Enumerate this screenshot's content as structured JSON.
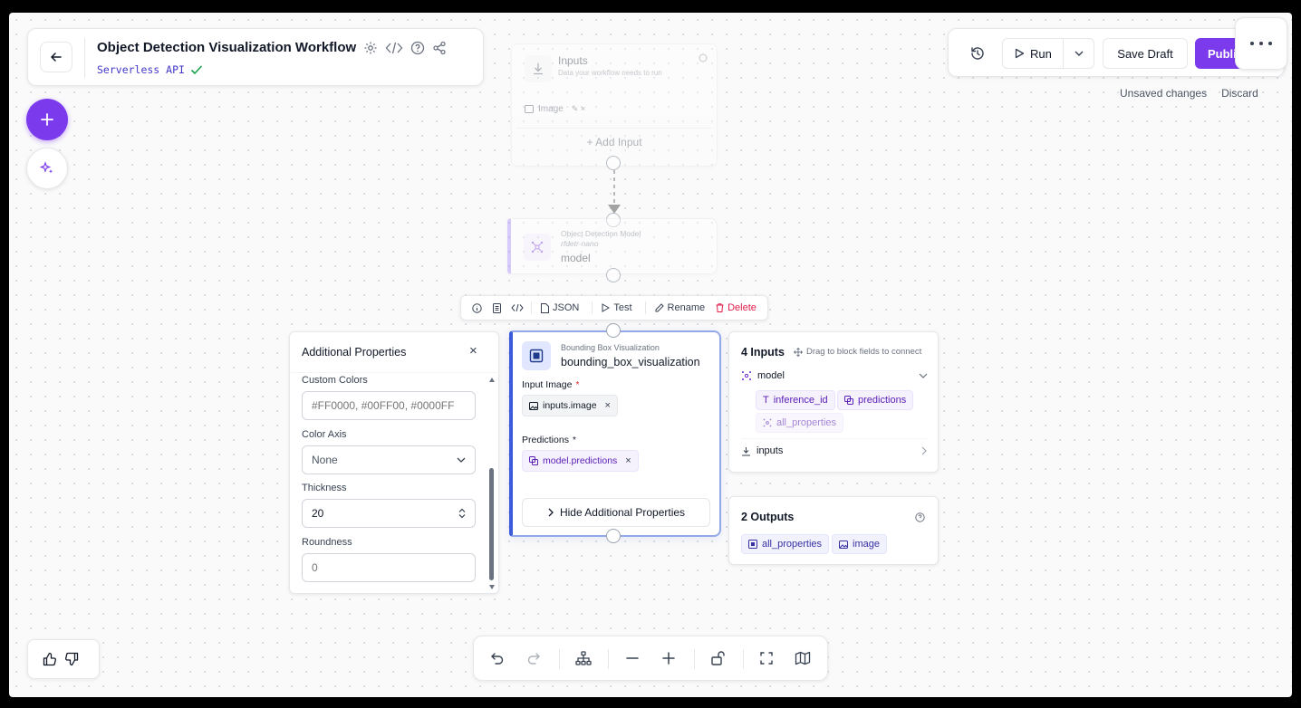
{
  "header": {
    "title": "Object Detection Visualization Workflow",
    "subtitle": "Serverless API",
    "icons": [
      "back-arrow-icon",
      "settings-icon",
      "code-icon",
      "help-icon",
      "share-icon"
    ]
  },
  "toolbar_right": {
    "run_label": "Run",
    "save_draft_label": "Save Draft",
    "publish_label": "Publi",
    "unsaved_label": "Unsaved changes",
    "discard_label": "Discard"
  },
  "inputs_node": {
    "title": "Inputs",
    "subtitle": "Data your workflow needs to run",
    "image_label": "Image",
    "add_input_label": "+ Add Input"
  },
  "model_node": {
    "type_label": "Object Detection Model",
    "model_id": "rfdetr-nano",
    "name": "model"
  },
  "node_toolbar": {
    "json_label": "JSON",
    "test_label": "Test",
    "rename_label": "Rename",
    "delete_label": "Delete"
  },
  "bbox_node": {
    "type_label": "Bounding Box Visualization",
    "name": "bounding_box_visualization",
    "input_image_label": "Input Image",
    "input_image_value": "inputs.image",
    "predictions_label": "Predictions",
    "predictions_value": "model.predictions",
    "hide_props_label": "Hide Additional Properties"
  },
  "additional_props": {
    "title": "Additional Properties",
    "custom_colors_label": "Custom Colors",
    "custom_colors_placeholder": "#FF0000, #00FF00, #0000FF",
    "color_axis_label": "Color Axis",
    "color_axis_value": "None",
    "thickness_label": "Thickness",
    "thickness_value": "20",
    "roundness_label": "Roundness",
    "roundness_placeholder": "0"
  },
  "inputs_panel": {
    "title": "4 Inputs",
    "hint": "Drag to block fields to connect",
    "model_label": "model",
    "chips": [
      "inference_id",
      "predictions",
      "all_properties"
    ],
    "inputs_label": "inputs"
  },
  "outputs_panel": {
    "title": "2 Outputs",
    "chips": [
      "all_properties",
      "image"
    ]
  },
  "bottom_toolbar": {
    "icons": [
      "undo-icon",
      "redo-icon",
      "layout-icon",
      "zoom-out-icon",
      "zoom-in-icon",
      "lock-icon",
      "fit-view-icon",
      "map-icon"
    ]
  },
  "feedback": {
    "icons": [
      "thumbs-up-icon",
      "thumbs-down-icon"
    ]
  },
  "colors": {
    "accent": "#7c3aed",
    "node_border": "#93a8e8",
    "node_bar": "#3b5bdb",
    "delete": "#e11d48"
  }
}
